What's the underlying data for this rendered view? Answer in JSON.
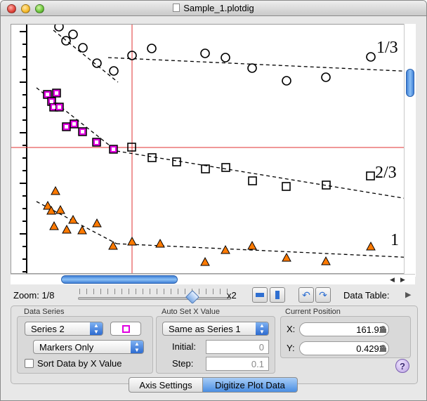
{
  "window": {
    "title": "Sample_1.plotdig"
  },
  "plot": {
    "series_labels": [
      "1/3",
      "2/3",
      "1"
    ],
    "marker_colors": {
      "series1": "#000000",
      "series2": "#e000e0",
      "series3": "#ff7a00"
    },
    "crosshair_color": "#e03030"
  },
  "zoom": {
    "label": "Zoom: 1/8",
    "max_label": "x2",
    "data_table_label": "Data Table:"
  },
  "data_series": {
    "group_label": "Data Series",
    "series_select": "Series 2",
    "marker_mode": "Markers Only",
    "sort_label": "Sort Data by X Value",
    "sort_checked": false
  },
  "auto_x": {
    "group_label": "Auto Set X Value",
    "mode": "Same as Series 1",
    "initial_label": "Initial:",
    "initial_value": "0",
    "step_label": "Step:",
    "step_value": "0.1"
  },
  "position": {
    "group_label": "Current Position",
    "x_label": "X:",
    "x_value": "161.92",
    "y_label": "Y:",
    "y_value": "0.4292"
  },
  "tabs": {
    "axis_settings": "Axis Settings",
    "digitize": "Digitize Plot Data"
  },
  "help_label": "?"
}
